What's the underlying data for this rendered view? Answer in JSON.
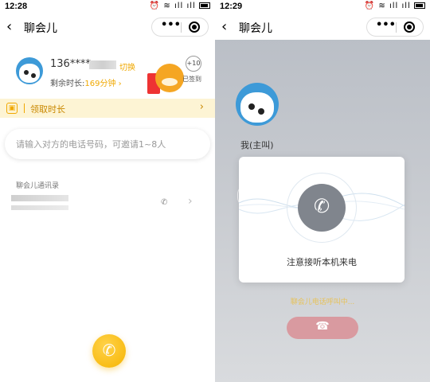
{
  "left": {
    "status": {
      "time": "12:28"
    },
    "title": "聊会儿",
    "profile": {
      "phone_prefix": "136****",
      "switch_label": "切换",
      "remaining_label": "剩余时长:",
      "remaining_value": "169分钟",
      "badge_plus": "+10",
      "signed_label": "已签到"
    },
    "banner": {
      "label": "领取时长"
    },
    "invite": {
      "placeholder": "请输入对方的电话号码，可邀请1~8人"
    },
    "contacts": {
      "title": "聊会儿通讯录"
    }
  },
  "right": {
    "status": {
      "time": "12:29"
    },
    "title": "聊会儿",
    "self_label": "我(主叫)",
    "card_text": "注意接听本机来电",
    "calling_text": "聊会儿电话呼叫中..."
  },
  "icons": {
    "back": "chevron-left-icon",
    "more": "more-dots-icon",
    "record": "target-icon",
    "call": "phone-icon",
    "hangup": "hangup-icon"
  },
  "colors": {
    "accent": "#f6b400",
    "banner_bg": "#fdf4d4",
    "avatar_blue": "#3d9ad8",
    "ring_gray": "#80858d",
    "hangup": "#d99aa0"
  }
}
